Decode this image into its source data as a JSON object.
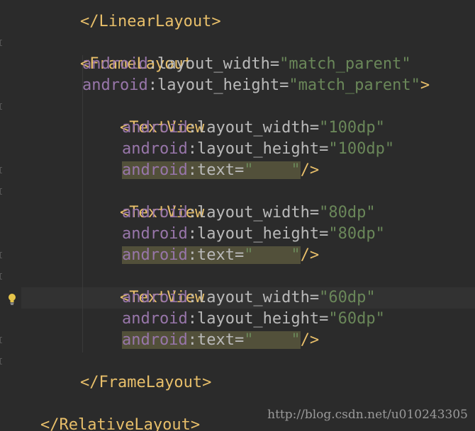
{
  "colors": {
    "background": "#2b2b2b",
    "tag": "#e8bf6a",
    "namespace": "#9876aa",
    "attribute": "#bababa",
    "value": "#6a8759",
    "highlight": "#52503a"
  },
  "code": {
    "l0": {
      "tag": "</LinearLayout>"
    },
    "l1": {
      "tag": "<FrameLayout"
    },
    "l2": {
      "ns": "android",
      "attr": ":layout_width=",
      "val": "\"match_parent\""
    },
    "l3": {
      "ns": "android",
      "attr": ":layout_height=",
      "val": "\"match_parent\"",
      "end": ">"
    },
    "l4": {
      "tag": "<TextView"
    },
    "l5": {
      "ns": "android",
      "attr": ":layout_width=",
      "val": "\"100dp\""
    },
    "l6": {
      "ns": "android",
      "attr": ":layout_height=",
      "val": "\"100dp\""
    },
    "l7": {
      "ns": "android",
      "attr": ":text=",
      "val": "\"    \"",
      "end": "/>"
    },
    "l8": {
      "tag": "<TextView"
    },
    "l9": {
      "ns": "android",
      "attr": ":layout_width=",
      "val": "\"80dp\""
    },
    "l10": {
      "ns": "android",
      "attr": ":layout_height=",
      "val": "\"80dp\""
    },
    "l11": {
      "ns": "android",
      "attr": ":text=",
      "val": "\"    \"",
      "end": "/>"
    },
    "l12": {
      "tag": "<TextView"
    },
    "l13": {
      "ns": "android",
      "attr": ":layout_width=",
      "val": "\"60dp\""
    },
    "l14": {
      "ns": "android",
      "attr": ":layout_height=",
      "val": "\"60dp\""
    },
    "l15": {
      "ns": "android",
      "attr": ":text=",
      "val": "\"    \"",
      "end": "/>"
    },
    "l16": {
      "tag": "</FrameLayout>"
    },
    "l17": {
      "tag": "</RelativeLayout>"
    }
  },
  "watermark": "http://blog.csdn.net/u010243305",
  "icons": {
    "intention": "lightbulb-icon"
  }
}
